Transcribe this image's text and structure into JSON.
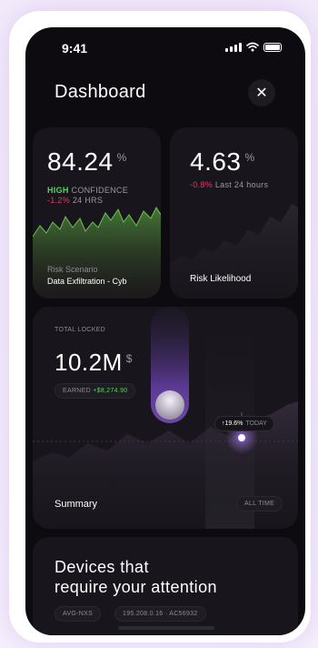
{
  "status": {
    "time": "9:41"
  },
  "header": {
    "title": "Dashboard"
  },
  "card1": {
    "value": "84.24",
    "unit": "%",
    "level": "HIGH",
    "level_suffix": "CONFIDENCE",
    "delta": "-1.2%",
    "period": "24 HRS",
    "scenario_label": "Risk Scenario",
    "scenario_value": "Data Exfiltration - Cyb"
  },
  "card2": {
    "value": "4.63",
    "unit": "%",
    "delta": "-0.8%",
    "period": "Last 24 hours",
    "title": "Risk Likelihood"
  },
  "summary": {
    "label": "TOTAL LOCKED",
    "value": "10.2M",
    "unit": "$",
    "earned_label": "EARNED",
    "earned_value": "+$8,274.90",
    "tooltip_value": "↑19.6%",
    "tooltip_suffix": "TODAY",
    "title": "Summary",
    "range_button": "ALL TIME"
  },
  "devices": {
    "line1": "Devices that",
    "line2": "require your attention",
    "tag": "AVG-NXS",
    "ip": "195.208.0.16",
    "separator": "·",
    "code": "AC56932"
  },
  "colors": {
    "green": "#58d35e",
    "red": "#e2385f",
    "purple": "#8b5ad4",
    "background": "#0d0b10",
    "card": "#18161c"
  }
}
